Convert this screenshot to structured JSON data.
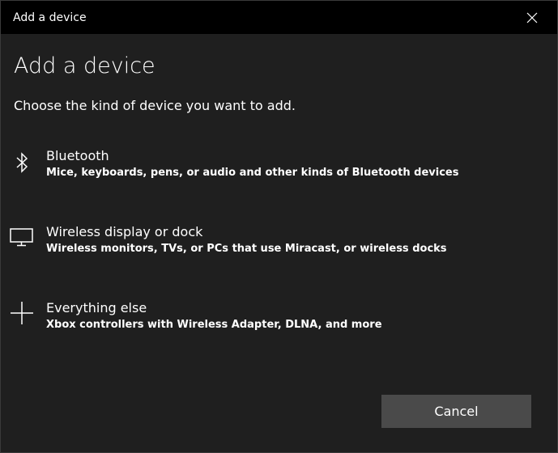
{
  "window": {
    "title": "Add a device",
    "close_icon": "close-icon"
  },
  "page": {
    "title": "Add a device",
    "subtitle": "Choose the kind of device you want to add."
  },
  "options": [
    {
      "icon": "bluetooth-icon",
      "title": "Bluetooth",
      "description": "Mice, keyboards, pens, or audio and other kinds of Bluetooth devices"
    },
    {
      "icon": "monitor-icon",
      "title": "Wireless display or dock",
      "description": "Wireless monitors, TVs, or PCs that use Miracast, or wireless docks"
    },
    {
      "icon": "plus-icon",
      "title": "Everything else",
      "description": "Xbox controllers with Wireless Adapter, DLNA, and more"
    }
  ],
  "buttons": {
    "cancel_label": "Cancel"
  },
  "colors": {
    "background": "#1f1f1f",
    "titlebar": "#000000",
    "button": "#4a4a4a",
    "text": "#ffffff"
  }
}
